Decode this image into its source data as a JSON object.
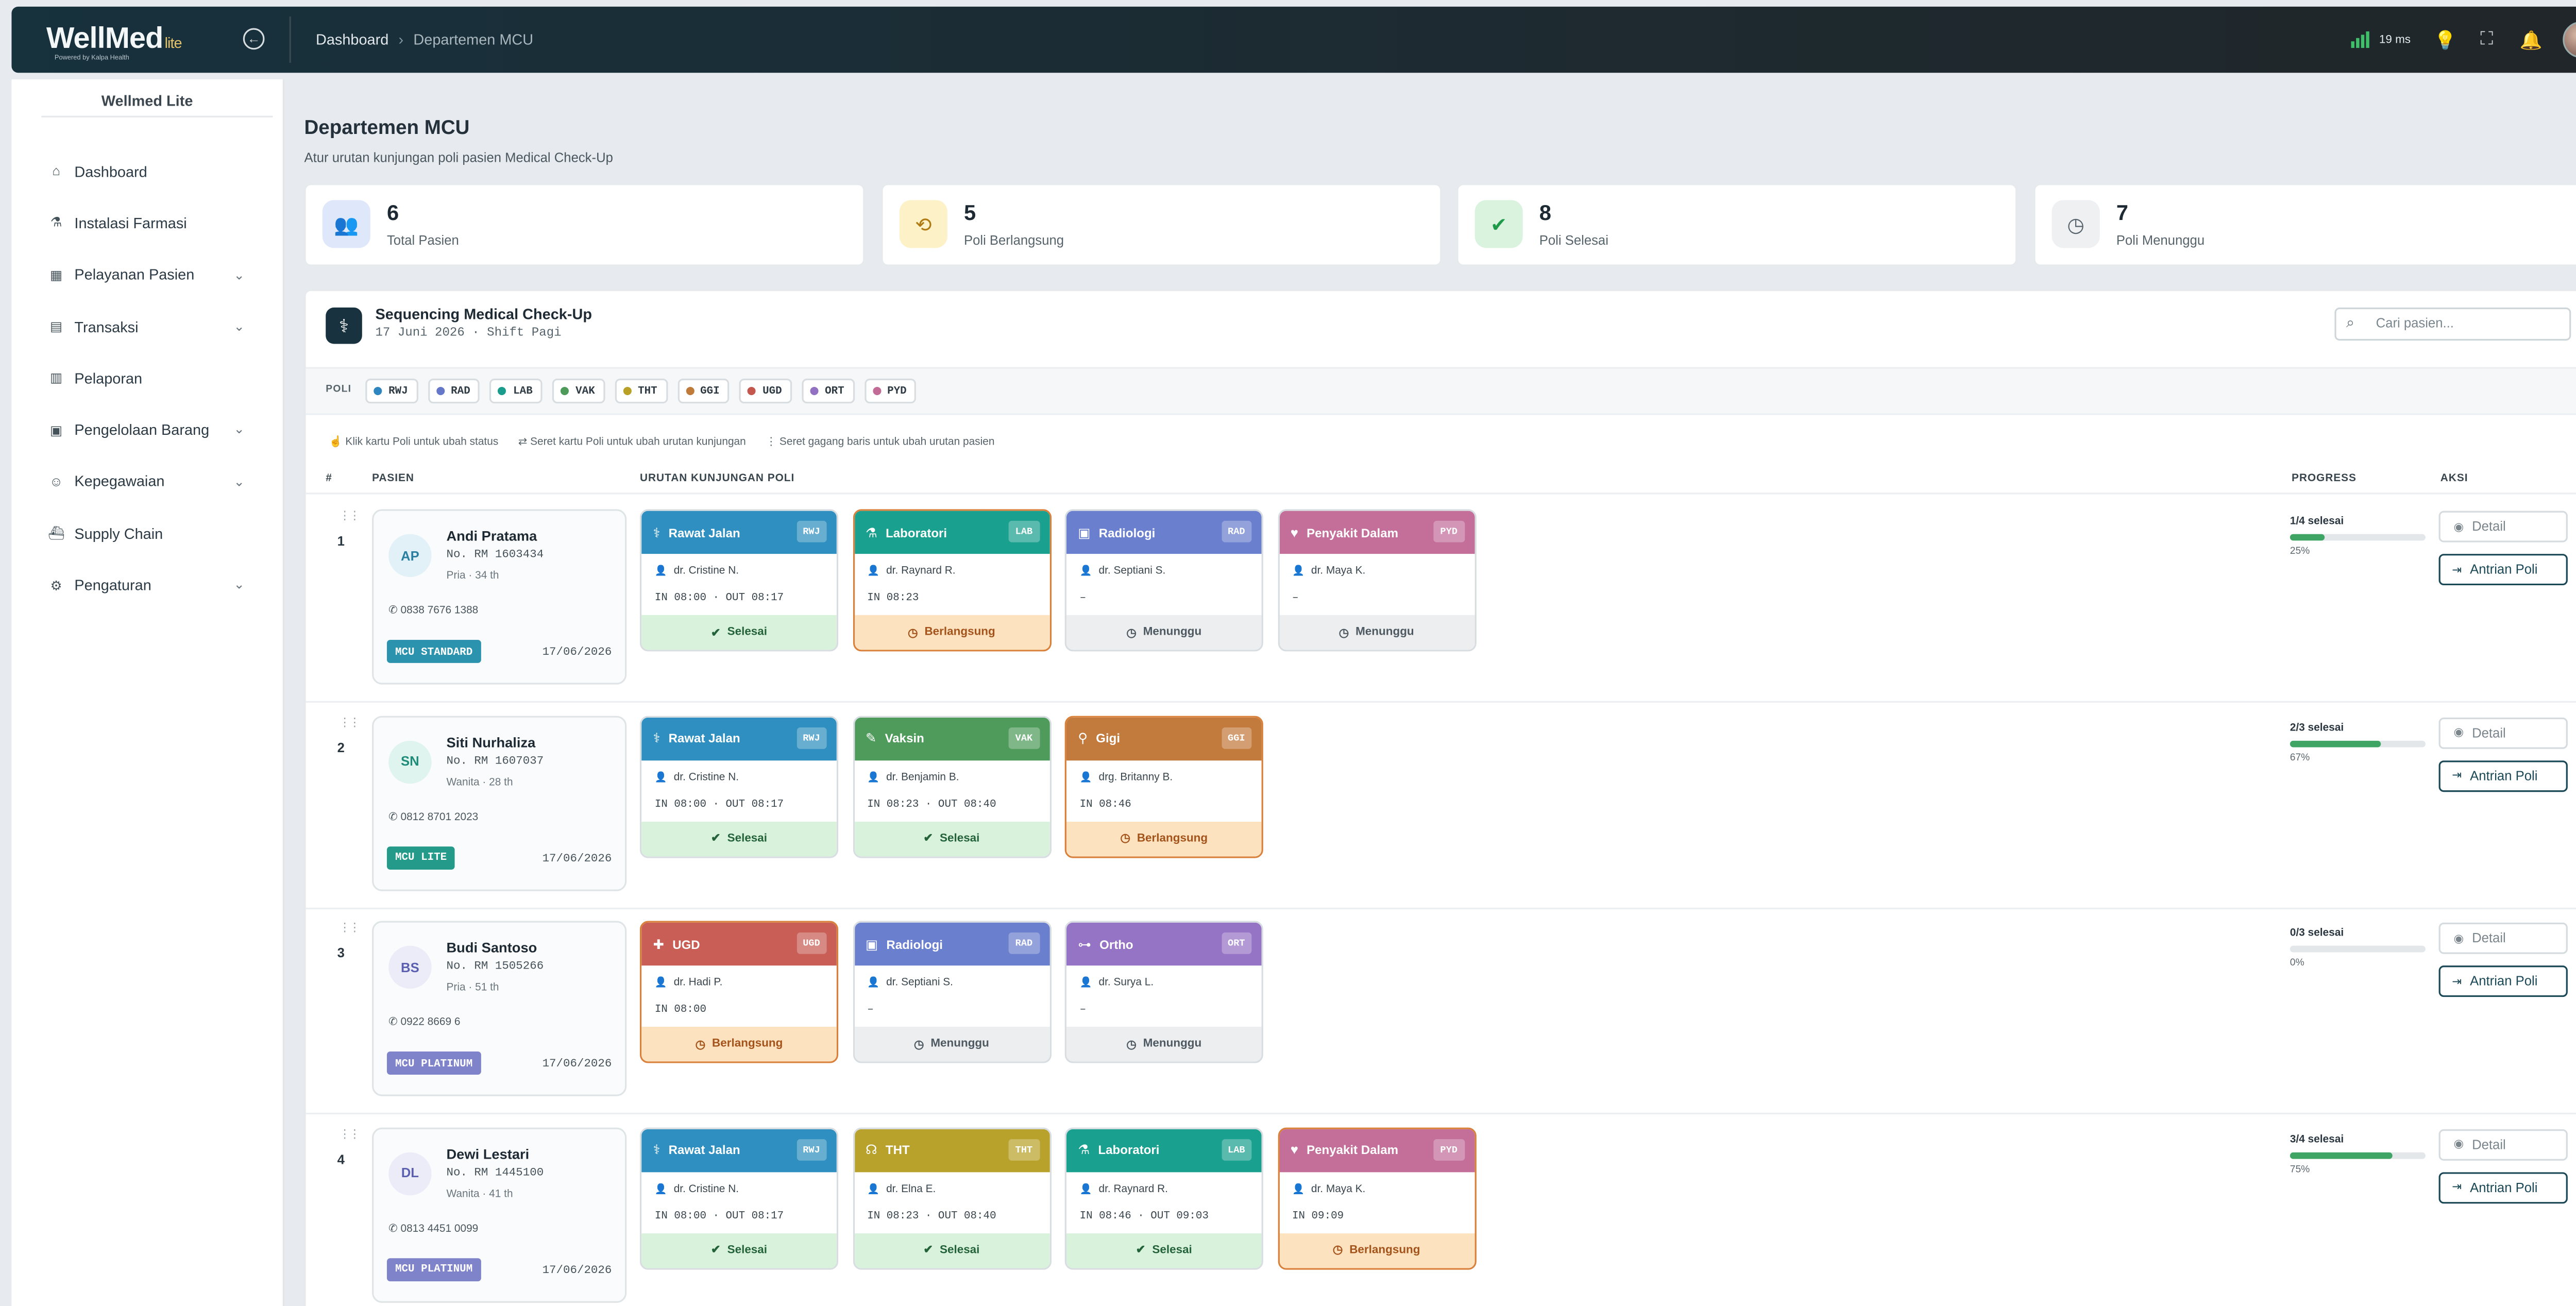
{
  "app": {
    "logo": "WellMed",
    "logo_suffix": "lite",
    "logo_tagline": "Powered by Kalpa Health",
    "latency": "19 ms"
  },
  "breadcrumb": [
    "Dashboard",
    "Departemen MCU"
  ],
  "sidebar": {
    "title": "Wellmed Lite",
    "items": [
      {
        "label": "Dashboard",
        "icon": "home-icon",
        "glyph": "⌂",
        "chevron": false
      },
      {
        "label": "Instalasi Farmasi",
        "icon": "pill-icon",
        "glyph": "⚗",
        "chevron": false
      },
      {
        "label": "Pelayanan Pasien",
        "icon": "hospital-icon",
        "glyph": "▦",
        "chevron": true
      },
      {
        "label": "Transaksi",
        "icon": "receipt-icon",
        "glyph": "▤",
        "chevron": true
      },
      {
        "label": "Pelaporan",
        "icon": "report-icon",
        "glyph": "▥",
        "chevron": false
      },
      {
        "label": "Pengelolaan Barang",
        "icon": "box-icon",
        "glyph": "▣",
        "chevron": true
      },
      {
        "label": "Kepegawaian",
        "icon": "staff-icon",
        "glyph": "☺",
        "chevron": true
      },
      {
        "label": "Supply Chain",
        "icon": "ship-icon",
        "glyph": "⛴",
        "chevron": false
      },
      {
        "label": "Pengaturan",
        "icon": "settings-icon",
        "glyph": "⚙",
        "chevron": true
      }
    ]
  },
  "page": {
    "title": "Departemen MCU",
    "subtitle": "Atur urutan kunjungan poli pasien Medical Check-Up"
  },
  "stats": [
    {
      "value": "6",
      "label": "Total Pasien",
      "icon": "users-icon",
      "glyph": "👥",
      "bg": "#dfe8fb",
      "fg": "#3b6fd8"
    },
    {
      "value": "5",
      "label": "Poli Berlangsung",
      "icon": "history-icon",
      "glyph": "⟲",
      "bg": "#fdf1c8",
      "fg": "#b07a12"
    },
    {
      "value": "8",
      "label": "Poli Selesai",
      "icon": "check-circle-icon",
      "glyph": "✔",
      "bg": "#d9f3df",
      "fg": "#1f9a4b"
    },
    {
      "value": "7",
      "label": "Poli Menunggu",
      "icon": "clock-icon",
      "glyph": "◷",
      "bg": "#eef0f2",
      "fg": "#56636b"
    }
  ],
  "panel": {
    "title": "Sequencing Medical Check-Up",
    "date": "17 Juni 2026 · Shift Pagi",
    "search_placeholder": "Cari pasien...",
    "poli_label": "POLI",
    "legend": [
      {
        "code": "RWJ",
        "color": "#2e86c1"
      },
      {
        "code": "RAD",
        "color": "#6577c9"
      },
      {
        "code": "LAB",
        "color": "#1a9c8c"
      },
      {
        "code": "VAK",
        "color": "#4d9a5a"
      },
      {
        "code": "THT",
        "color": "#b9a026"
      },
      {
        "code": "GGI",
        "color": "#c07a3a"
      },
      {
        "code": "UGD",
        "color": "#c4584f"
      },
      {
        "code": "ORT",
        "color": "#9270c2"
      },
      {
        "code": "PYD",
        "color": "#c26b96"
      }
    ],
    "hints": [
      "Klik kartu Poli untuk ubah status",
      "Seret kartu Poli untuk ubah urutan kunjungan",
      "Seret gagang baris untuk ubah urutan pasien"
    ],
    "columns": {
      "no": "#",
      "patient": "PASIEN",
      "sequence": "URUTAN KUNJUNGAN POLI",
      "progress": "PROGRESS",
      "action": "AKSI"
    }
  },
  "buttons": {
    "detail": "Detail",
    "queue": "Antrian Poli"
  },
  "patients": [
    {
      "no": "1",
      "initials": "AP",
      "name": "Andi Pratama",
      "rm": "No. RM 1603434",
      "info": "Pria · 34 th",
      "phone": "0838 7676 1388",
      "package": "MCU STANDARD",
      "package_color": "#2b93ad",
      "date": "17/06/2026",
      "avatar_bg": "#e2f1f7",
      "avatar_fg": "#2b7fa0",
      "progress_text": "1/4 selesai",
      "progress": 0.25,
      "progress_pct": "25%",
      "visits": [
        {
          "name": "Rawat Jalan",
          "code": "RWJ",
          "color": "#2f8fc0",
          "icon": "stethoscope-icon",
          "glyph": "⚕",
          "doctor": "dr. Cristine N.",
          "time": "IN 08:00 · OUT 08:17",
          "status": "Selesai",
          "state": "selesai"
        },
        {
          "name": "Laboratori",
          "code": "LAB",
          "color": "#1aa08e",
          "icon": "flask-icon",
          "glyph": "⚗",
          "doctor": "dr. Raynard R.",
          "time": "IN 08:23",
          "status": "Berlangsung",
          "state": "berl"
        },
        {
          "name": "Radiologi",
          "code": "RAD",
          "color": "#6b7fcf",
          "icon": "xray-icon",
          "glyph": "▣",
          "doctor": "dr. Septiani S.",
          "time": "–",
          "status": "Menunggu",
          "state": "mng"
        },
        {
          "name": "Penyakit Dalam",
          "code": "PYD",
          "color": "#c46e9a",
          "icon": "heart-icon",
          "glyph": "♥",
          "doctor": "dr. Maya K.",
          "time": "–",
          "status": "Menunggu",
          "state": "mng"
        }
      ]
    },
    {
      "no": "2",
      "initials": "SN",
      "name": "Siti Nurhaliza",
      "rm": "No. RM 1607037",
      "info": "Wanita · 28 th",
      "phone": "0812 8701 2023",
      "package": "MCU LITE",
      "package_color": "#249a8a",
      "date": "17/06/2026",
      "avatar_bg": "#e0f4ef",
      "avatar_fg": "#1e8c78",
      "progress_text": "2/3 selesai",
      "progress": 0.67,
      "progress_pct": "67%",
      "visits": [
        {
          "name": "Rawat Jalan",
          "code": "RWJ",
          "color": "#2f8fc0",
          "icon": "stethoscope-icon",
          "glyph": "⚕",
          "doctor": "dr. Cristine N.",
          "time": "IN 08:00 · OUT 08:17",
          "status": "Selesai",
          "state": "selesai"
        },
        {
          "name": "Vaksin",
          "code": "VAK",
          "color": "#4f9b5c",
          "icon": "syringe-icon",
          "glyph": "✎",
          "doctor": "dr. Benjamin B.",
          "time": "IN 08:23 · OUT 08:40",
          "status": "Selesai",
          "state": "selesai"
        },
        {
          "name": "Gigi",
          "code": "GGI",
          "color": "#c27b3c",
          "icon": "tooth-icon",
          "glyph": "⚲",
          "doctor": "drg. Britanny B.",
          "time": "IN 08:46",
          "status": "Berlangsung",
          "state": "berl"
        }
      ]
    },
    {
      "no": "3",
      "initials": "BS",
      "name": "Budi Santoso",
      "rm": "No. RM 1505266",
      "info": "Pria · 51 th",
      "phone": "0922 8669 6",
      "package": "MCU PLATINUM",
      "package_color": "#7f83c9",
      "date": "17/06/2026",
      "avatar_bg": "#ebecf8",
      "avatar_fg": "#5a5fb0",
      "progress_text": "0/3 selesai",
      "progress": 0,
      "progress_pct": "0%",
      "visits": [
        {
          "name": "UGD",
          "code": "UGD",
          "color": "#c85e55",
          "icon": "first-aid-icon",
          "glyph": "✚",
          "doctor": "dr. Hadi P.",
          "time": "IN 08:00",
          "status": "Berlangsung",
          "state": "berl"
        },
        {
          "name": "Radiologi",
          "code": "RAD",
          "color": "#6b7fcf",
          "icon": "xray-icon",
          "glyph": "▣",
          "doctor": "dr. Septiani S.",
          "time": "–",
          "status": "Menunggu",
          "state": "mng"
        },
        {
          "name": "Ortho",
          "code": "ORT",
          "color": "#9674c5",
          "icon": "bone-icon",
          "glyph": "⊶",
          "doctor": "dr. Surya L.",
          "time": "–",
          "status": "Menunggu",
          "state": "mng"
        }
      ]
    },
    {
      "no": "4",
      "initials": "DL",
      "name": "Dewi Lestari",
      "rm": "No. RM 1445100",
      "info": "Wanita · 41 th",
      "phone": "0813 4451 0099",
      "package": "MCU PLATINUM",
      "package_color": "#7f83c9",
      "date": "17/06/2026",
      "avatar_bg": "#ebecf8",
      "avatar_fg": "#5a5fb0",
      "progress_text": "3/4 selesai",
      "progress": 0.75,
      "progress_pct": "75%",
      "visits": [
        {
          "name": "Rawat Jalan",
          "code": "RWJ",
          "color": "#2f8fc0",
          "icon": "stethoscope-icon",
          "glyph": "⚕",
          "doctor": "dr. Cristine N.",
          "time": "IN 08:00 · OUT 08:17",
          "status": "Selesai",
          "state": "selesai"
        },
        {
          "name": "THT",
          "code": "THT",
          "color": "#b9a22c",
          "icon": "ear-icon",
          "glyph": "☊",
          "doctor": "dr. Elna E.",
          "time": "IN 08:23 · OUT 08:40",
          "status": "Selesai",
          "state": "selesai"
        },
        {
          "name": "Laboratori",
          "code": "LAB",
          "color": "#1aa08e",
          "icon": "flask-icon",
          "glyph": "⚗",
          "doctor": "dr. Raynard R.",
          "time": "IN 08:46 · OUT 09:03",
          "status": "Selesai",
          "state": "selesai"
        },
        {
          "name": "Penyakit Dalam",
          "code": "PYD",
          "color": "#c46e9a",
          "icon": "heart-icon",
          "glyph": "♥",
          "doctor": "dr. Maya K.",
          "time": "IN 09:09",
          "status": "Berlangsung",
          "state": "berl"
        }
      ]
    }
  ]
}
